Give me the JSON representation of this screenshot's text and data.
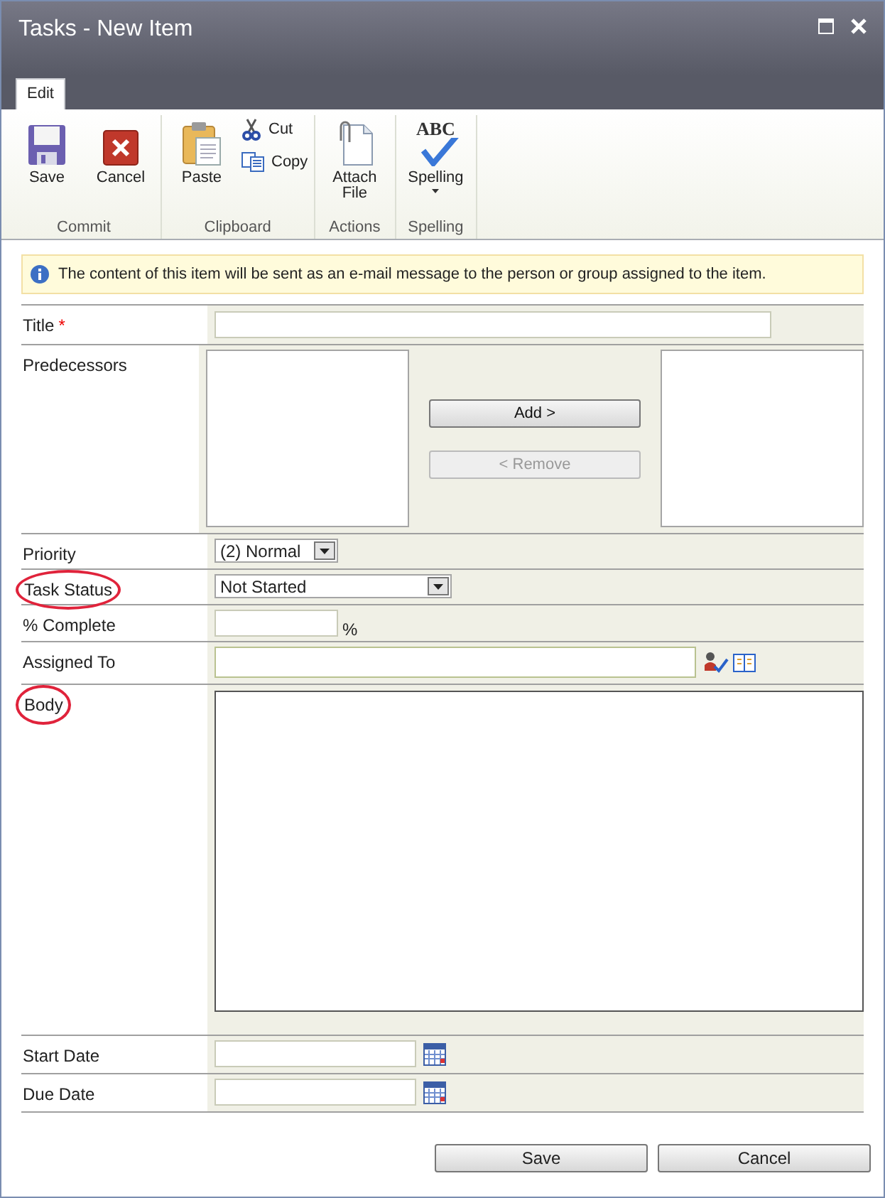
{
  "window": {
    "title": "Tasks - New Item"
  },
  "tabs": [
    {
      "label": "Edit",
      "selected": true
    }
  ],
  "ribbon_groups": [
    {
      "label": "Commit",
      "items": [
        {
          "label": "Save",
          "kind": "large"
        },
        {
          "label": "Cancel",
          "kind": "large"
        }
      ]
    },
    {
      "label": "Clipboard",
      "items": [
        {
          "label": "Paste",
          "kind": "large"
        },
        {
          "label": "Cut",
          "kind": "small"
        },
        {
          "label": "Copy",
          "kind": "small"
        }
      ]
    },
    {
      "label": "Actions",
      "items": [
        {
          "label": "Attach File",
          "kind": "large"
        }
      ]
    },
    {
      "label": "Spelling",
      "items": [
        {
          "label": "Spelling",
          "kind": "large",
          "dropdown": true,
          "icon_text": "ABC"
        }
      ]
    }
  ],
  "info_message": "The content of this item will be sent as an e-mail message to the person or group assigned to the item.",
  "fields": [
    {
      "label": "Title",
      "kind": "text",
      "required": true,
      "required_mark": "*",
      "circled": false
    },
    {
      "label": "Predecessors",
      "kind": "multiselect",
      "circled": false,
      "buttons": [
        {
          "label": "Add >",
          "disabled": false
        },
        {
          "label": "< Remove",
          "disabled": true
        }
      ]
    },
    {
      "label": "Priority",
      "kind": "select",
      "value": "(2) Normal",
      "circled": false
    },
    {
      "label": "Task Status",
      "kind": "select",
      "value": "Not Started",
      "circled": true
    },
    {
      "label": "% Complete",
      "kind": "percent",
      "suffix": "%",
      "circled": false
    },
    {
      "label": "Assigned To",
      "kind": "people",
      "circled": false
    },
    {
      "label": "Body",
      "kind": "textarea",
      "circled": true
    },
    {
      "label": "Start Date",
      "kind": "date",
      "circled": false
    },
    {
      "label": "Due Date",
      "kind": "date",
      "circled": false
    }
  ],
  "buttons": [
    "Save",
    "Cancel"
  ]
}
